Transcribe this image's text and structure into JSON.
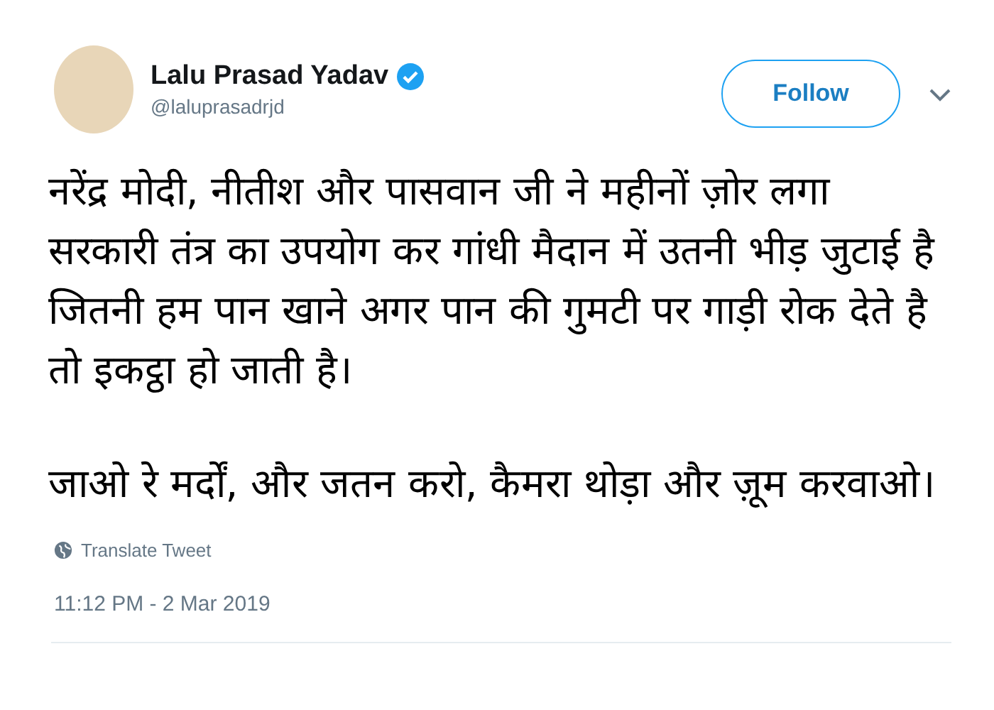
{
  "author": {
    "name": "Lalu Prasad Yadav",
    "verified": true,
    "handle": "@laluprasadrjd"
  },
  "follow_button": {
    "label": "Follow"
  },
  "tweet": {
    "paragraphs": [
      "नरेंद्र मोदी, नीतीश और पासवान जी ने महीनों ज़ोर लगा सरकारी तंत्र का उपयोग कर गांधी मैदान में उतनी भीड़ जुटाई है जितनी हम पान खाने अगर पान की गुमटी पर गाड़ी रोक देते है तो इकट्ठा हो जाती है।",
      "जाओ रे मर्दों, और जतन करो, कैमरा थोड़ा और ज़ूम करवाओ।"
    ],
    "translate_link": "Translate Tweet",
    "timestamp": "11:12 PM - 2 Mar 2019"
  }
}
